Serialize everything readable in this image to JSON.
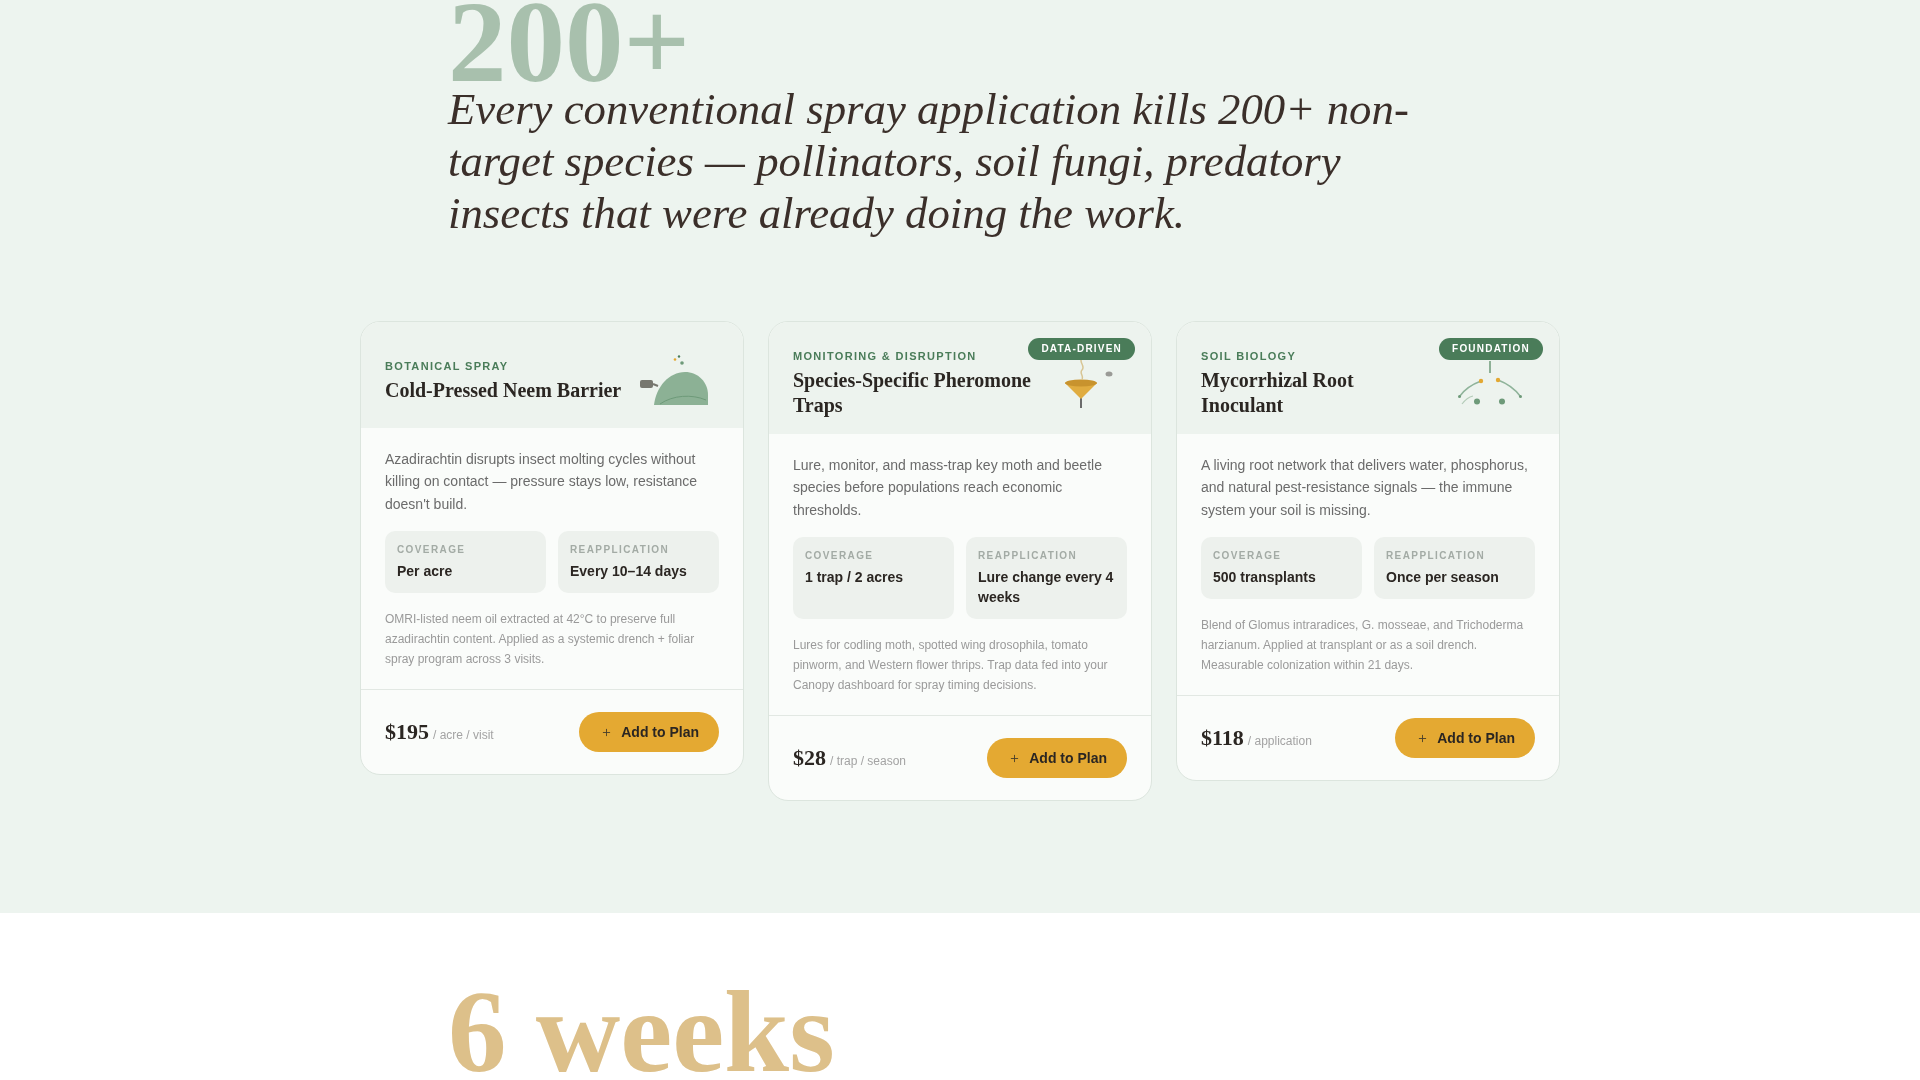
{
  "hero": {
    "stat": "200+",
    "quote": "Every conventional spray application kills 200+ non-target species — pollinators, soil fungi, predatory insects that were already doing the work."
  },
  "products": [
    {
      "kind": "sprayer",
      "category": "BOTANICAL SPRAY",
      "title": "Cold-Pressed Neem Barrier",
      "description": "Azadirachtin disrupts insect molting cycles without killing on contact — pressure stays low, resistance doesn't build.",
      "specs": [
        {
          "label": "COVERAGE",
          "value": "Per acre"
        },
        {
          "label": "REAPPLICATION",
          "value": "Every 10–14 days"
        }
      ],
      "details": "OMRI-listed neem oil extracted at 42°C to preserve full azadirachtin content. Applied as a systemic drench + foliar spray program across 3 visits.",
      "price": "$195",
      "unit": "/ acre / visit",
      "button": "Add to Plan"
    },
    {
      "kind": "trap",
      "category": "MONITORING & DISRUPTION",
      "badge": "DATA-DRIVEN",
      "title": "Species-Specific Pheromone Traps",
      "description": "Lure, monitor, and mass-trap key moth and beetle species before populations reach economic thresholds.",
      "specs": [
        {
          "label": "COVERAGE",
          "value": "1 trap / 2 acres"
        },
        {
          "label": "REAPPLICATION",
          "value": "Lure change every 4 weeks"
        }
      ],
      "details": "Lures for codling moth, spotted wing drosophila, tomato pinworm, and Western flower thrips. Trap data fed into your Canopy dashboard for spray timing decisions.",
      "price": "$28",
      "unit": "/ trap / season",
      "button": "Add to Plan"
    },
    {
      "kind": "roots",
      "category": "SOIL BIOLOGY",
      "badge": "FOUNDATION",
      "title": "Mycorrhizal Root Inoculant",
      "description": "A living root network that delivers water, phosphorus, and natural pest-resistance signals — the immune system your soil is missing.",
      "specs": [
        {
          "label": "COVERAGE",
          "value": "500 transplants"
        },
        {
          "label": "REAPPLICATION",
          "value": "Once per season"
        }
      ],
      "details": "Blend of Glomus intraradices, G. mosseae, and Trichoderma harzianum. Applied at transplant or as a soil drench. Measurable colonization within 21 days.",
      "price": "$118",
      "unit": "/ application",
      "button": "Add to Plan"
    }
  ],
  "next_section": {
    "stat": "6 weeks"
  }
}
